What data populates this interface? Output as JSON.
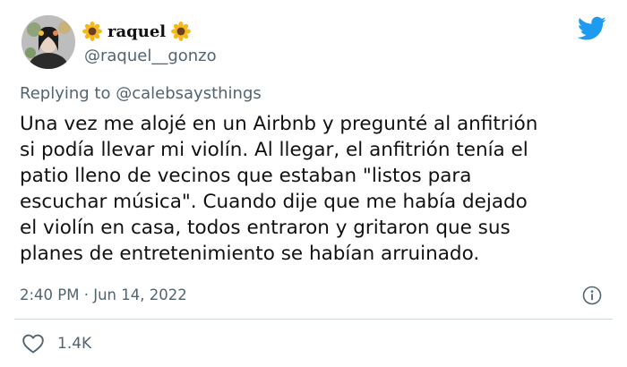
{
  "author": {
    "display_name": "raquel",
    "name_decoration_icon": "sunflower-emoji",
    "handle": "@raquel__gonzo"
  },
  "reply": {
    "prefix": "Replying to ",
    "mention": "@calebsaysthings"
  },
  "tweet": {
    "lines": [
      "Una vez me alojé en un Airbnb y pregunté al anfitrión",
      "si podía llevar mi violín. Al llegar, el anfitrión tenía el",
      "patio lleno de vecinos que estaban \"listos para",
      "escuchar música\". Cuando dije que me había dejado",
      "el violín en casa, todos entraron y gritaron que sus",
      "planes de entretenimiento se habían arruinado."
    ],
    "timestamp": "2:40 PM · Jun 14, 2022"
  },
  "engagement": {
    "likes": "1.4K"
  },
  "colors": {
    "twitter_blue": "#1d9bf0",
    "secondary_text": "#536471",
    "divider": "#cfd9de"
  }
}
